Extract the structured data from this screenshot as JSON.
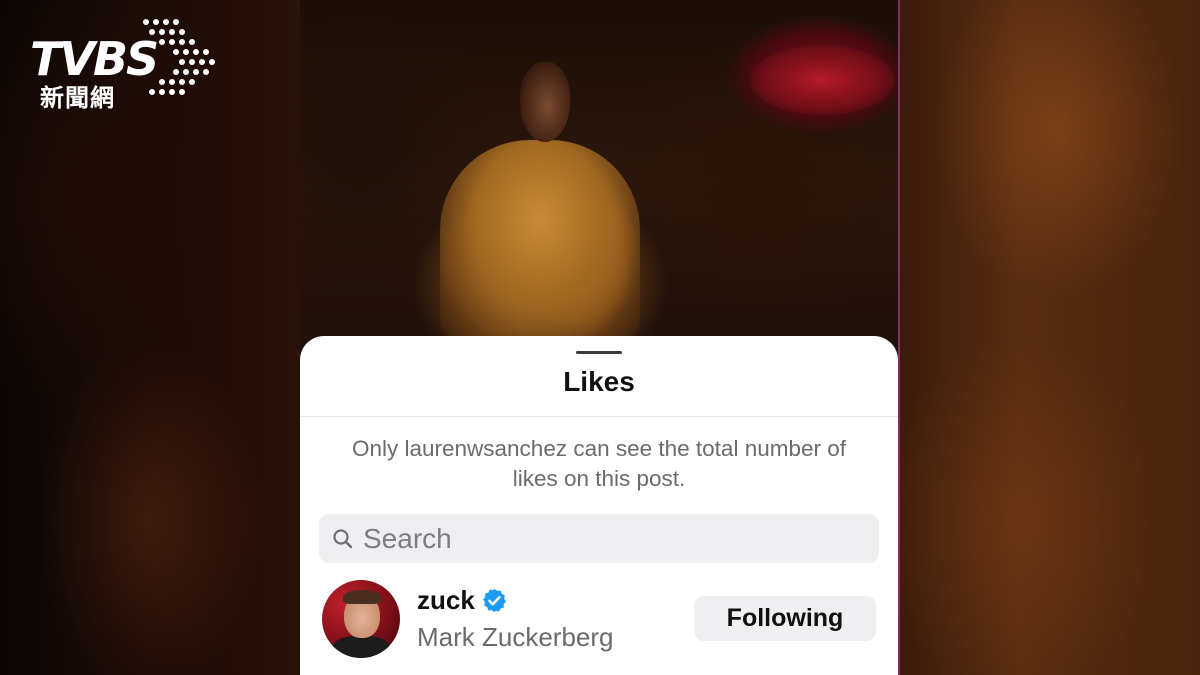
{
  "branding": {
    "logo_text": "TVBS",
    "logo_subtitle": "新聞網"
  },
  "sheet": {
    "title": "Likes",
    "notice": "Only laurenwsanchez can see the total number of likes on this post.",
    "search": {
      "placeholder": "Search",
      "value": ""
    },
    "likes_list": [
      {
        "username": "zuck",
        "verified": true,
        "full_name": "Mark Zuckerberg",
        "follow_button_label": "Following"
      }
    ]
  },
  "colors": {
    "verified_blue": "#1d9bf0",
    "sheet_background": "#ffffff",
    "muted_text": "#6b6b6b",
    "button_background": "#efeff1"
  },
  "icons": {
    "search": "search-icon",
    "verified": "verified-badge-icon"
  }
}
